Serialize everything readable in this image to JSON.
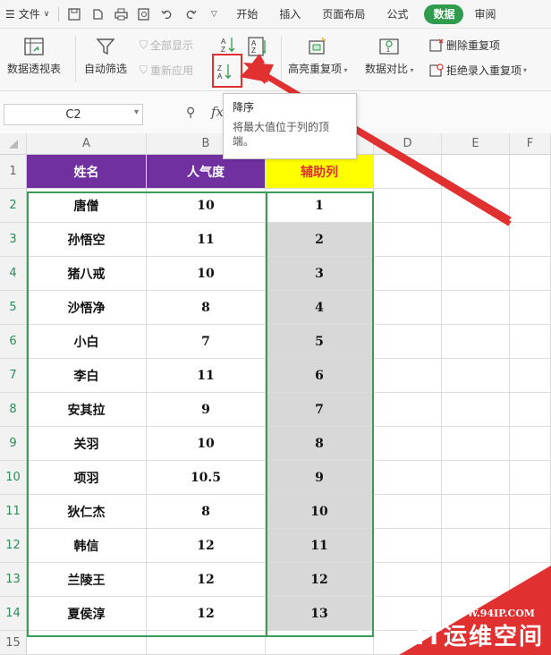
{
  "menubar": {
    "file_label": "文件",
    "tabs": [
      "开始",
      "插入",
      "页面布局",
      "公式",
      "数据",
      "审阅"
    ],
    "active_tab": "数据"
  },
  "ribbon": {
    "pivot_table": "数据透视表",
    "auto_filter": "自动筛选",
    "show_all": "全部显示",
    "reapply": "重新应用",
    "sort_label": "排序",
    "highlight_dup": "高亮重复项",
    "data_compare": "数据对比",
    "remove_dup": "删除重复项",
    "reject_dup": "拒绝录入重复项"
  },
  "tooltip": {
    "title": "降序",
    "desc": "将最大值位于列的顶端。"
  },
  "formula_bar": {
    "name_box": "C2",
    "fx": "fx"
  },
  "grid": {
    "columns": [
      "A",
      "B",
      "C",
      "D",
      "E",
      "F"
    ],
    "rows": [
      "1",
      "2",
      "3",
      "4",
      "5",
      "6",
      "7",
      "8",
      "9",
      "10",
      "11",
      "12",
      "13",
      "14",
      "15"
    ],
    "header": [
      "姓名",
      "人气度",
      "辅助列"
    ],
    "data": [
      [
        "唐僧",
        "10",
        "1"
      ],
      [
        "孙悟空",
        "11",
        "2"
      ],
      [
        "猪八戒",
        "10",
        "3"
      ],
      [
        "沙悟净",
        "8",
        "4"
      ],
      [
        "小白",
        "7",
        "5"
      ],
      [
        "李白",
        "11",
        "6"
      ],
      [
        "安其拉",
        "9",
        "7"
      ],
      [
        "关羽",
        "10",
        "8"
      ],
      [
        "项羽",
        "10.5",
        "9"
      ],
      [
        "狄仁杰",
        "8",
        "10"
      ],
      [
        "韩信",
        "12",
        "11"
      ],
      [
        "兰陵王",
        "12",
        "12"
      ],
      [
        "夏侯淳",
        "12",
        "13"
      ]
    ]
  },
  "watermark": {
    "url": "WWW.94IP.COM",
    "name": "IT运维空间"
  },
  "colors": {
    "header_purple": "#7030a0",
    "header_yellow": "#ffff00",
    "accent_green": "#2e9c4c",
    "arrow_red": "#e03030"
  }
}
